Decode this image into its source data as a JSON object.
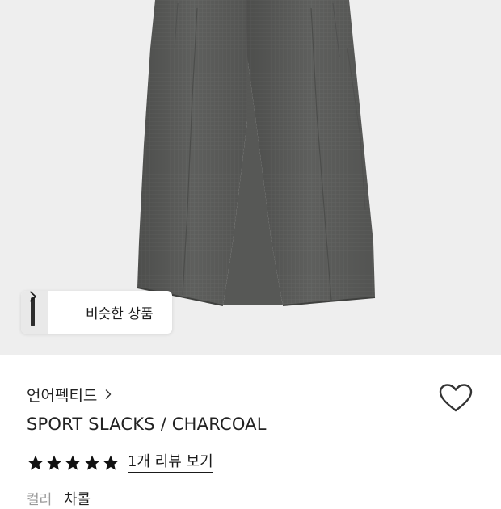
{
  "hero": {
    "image": "charcoal-pleated-slacks-photo",
    "background": "#eeeeee",
    "fabric_color": "#5c5d5b"
  },
  "similar": {
    "label": "비슷한 상품",
    "icon": "chevron-right-icon"
  },
  "product": {
    "brand": "언어펙티드",
    "brand_icon": "chevron-right-icon",
    "title": "SPORT SLACKS / CHARCOAL",
    "wishlist_icon": "heart-outline-icon",
    "rating": {
      "stars": 5,
      "max": 5,
      "review_link": "1개 리뷰 보기"
    },
    "color": {
      "label": "컬러",
      "value": "차콜"
    }
  }
}
